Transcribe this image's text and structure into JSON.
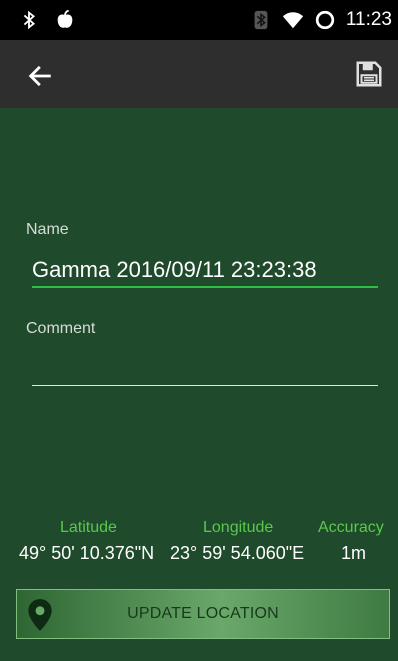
{
  "status_bar": {
    "time": "11:23",
    "icons": [
      "bluetooth-icon",
      "apple-icon",
      "bluetooth-icon",
      "wifi-icon",
      "sync-circle-icon"
    ]
  },
  "toolbar": {
    "back_icon": "arrow-left-icon",
    "save_icon": "floppy-disk-icon"
  },
  "form": {
    "name_label": "Name",
    "name_value": "Gamma 2016/09/11 23:23:38",
    "comment_label": "Comment",
    "comment_value": ""
  },
  "coordinates": {
    "latitude_label": "Latitude",
    "longitude_label": "Longitude",
    "accuracy_label": "Accuracy",
    "latitude_value": "49° 50' 10.376\"N",
    "longitude_value": "23° 59' 54.060\"E",
    "accuracy_value": "1m"
  },
  "update_button": {
    "label": "UPDATE LOCATION",
    "icon": "map-pin-icon"
  },
  "colors": {
    "background": "#1f4a2c",
    "accent_green": "#2fbf45",
    "coord_label_green": "#59c94c",
    "toolbar": "#2e2e2e"
  }
}
